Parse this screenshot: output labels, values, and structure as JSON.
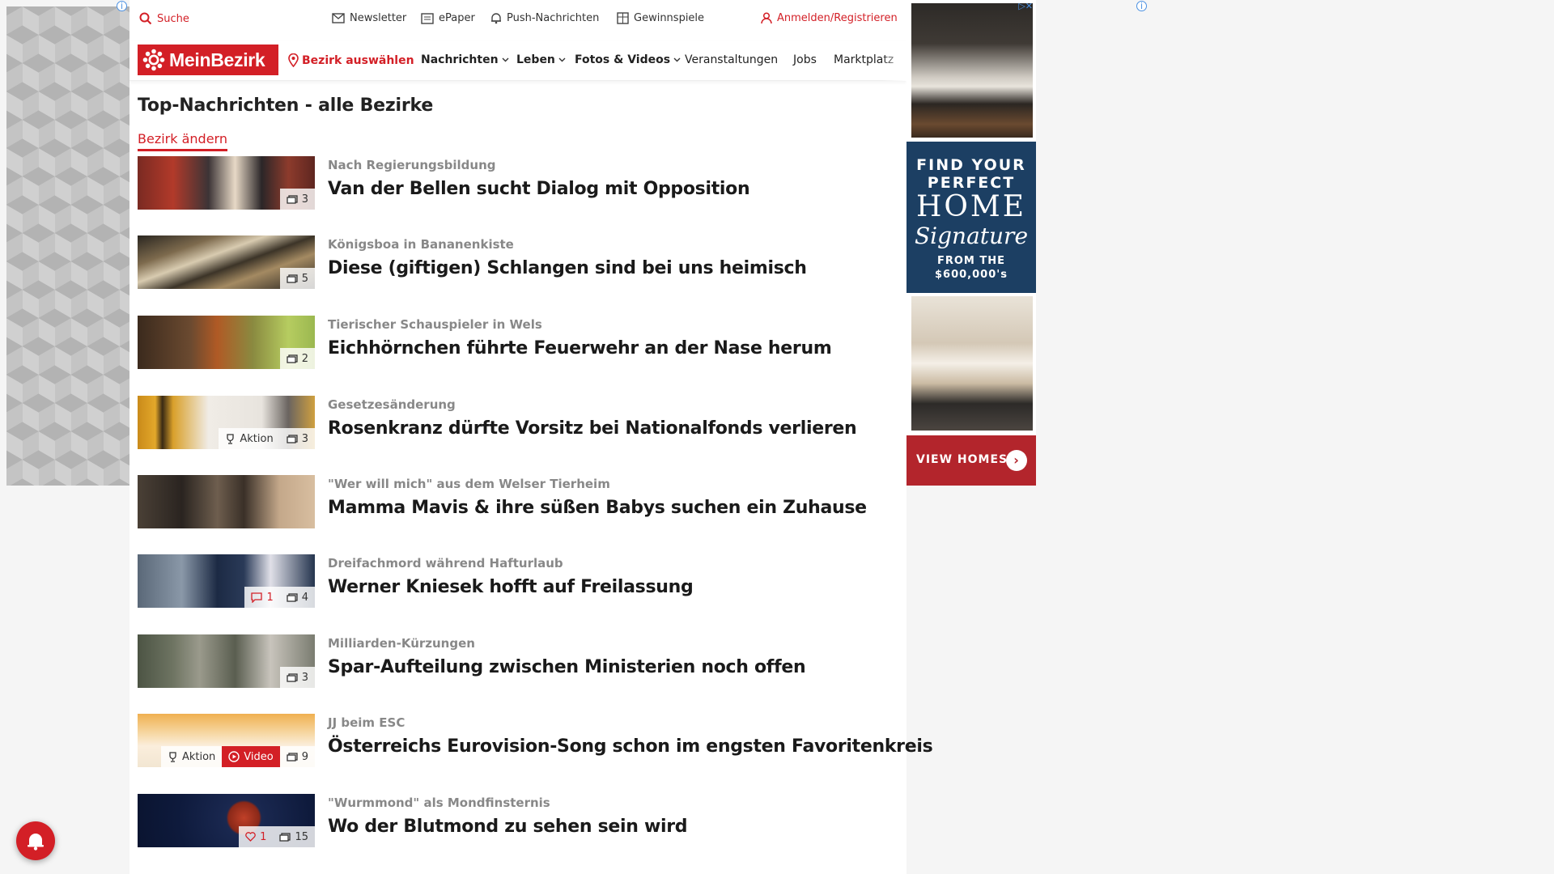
{
  "topbar": {
    "search": "Suche",
    "newsletter": "Newsletter",
    "epaper": "ePaper",
    "push": "Push-Nachrichten",
    "contests": "Gewinnspiele",
    "login": "Anmelden/Registrieren"
  },
  "nav": {
    "logo": "MeinBezirk",
    "region": "Bezirk auswählen",
    "news": "Nachrichten",
    "life": "Leben",
    "media": "Fotos & Videos",
    "events": "Veranstaltungen",
    "jobs": "Jobs",
    "market": "Marktplatz"
  },
  "main": {
    "title": "Top-Nachrichten - alle Bezirke",
    "change_link": "Bezirk ändern",
    "articles": [
      {
        "kicker": "Nach Regierungsbildung",
        "headline": "Van der Bellen sucht Dialog mit Opposition",
        "photos": "3"
      },
      {
        "kicker": "Königsboa in Bananenkiste",
        "headline": "Diese (giftigen) Schlangen sind bei uns heimisch",
        "photos": "5"
      },
      {
        "kicker": "Tierischer Schauspieler in Wels",
        "headline": "Eichhörnchen führte Feuerwehr an der Nase herum",
        "photos": "2"
      },
      {
        "kicker": "Gesetzesänderung",
        "headline": "Rosenkranz dürfte Vorsitz bei Nationalfonds verlieren",
        "photos": "3",
        "action": "Aktion"
      },
      {
        "kicker": "\"Wer will mich\" aus dem Welser Tierheim",
        "headline": "Mamma Mavis & ihre süßen Babys suchen ein Zuhause"
      },
      {
        "kicker": "Dreifachmord während Hafturlaub",
        "headline": "Werner Kniesek hofft auf Freilassung",
        "photos": "4",
        "comments": "1"
      },
      {
        "kicker": "Milliarden-Kürzungen",
        "headline": "Spar-Aufteilung zwischen Ministerien noch offen",
        "photos": "3"
      },
      {
        "kicker": "JJ beim ESC",
        "headline": "Österreichs Eurovision-Song schon im engsten Favoritenkreis",
        "photos": "9",
        "action": "Aktion",
        "video": "Video"
      },
      {
        "kicker": "\"Wurmmond\" als Mondfinsternis",
        "headline": "Wo der Blutmond zu sehen sein wird",
        "photos": "15",
        "likes": "1"
      }
    ]
  },
  "ad": {
    "line1": "FIND YOUR",
    "line2": "PERFECT",
    "line3": "HOME",
    "brand": "Signature",
    "line5": "FROM THE",
    "line6": "$600,000's",
    "cta": "VIEW HOMES"
  },
  "colors": {
    "brand_red": "#d31f26",
    "ad_blue": "#1c3f63"
  }
}
